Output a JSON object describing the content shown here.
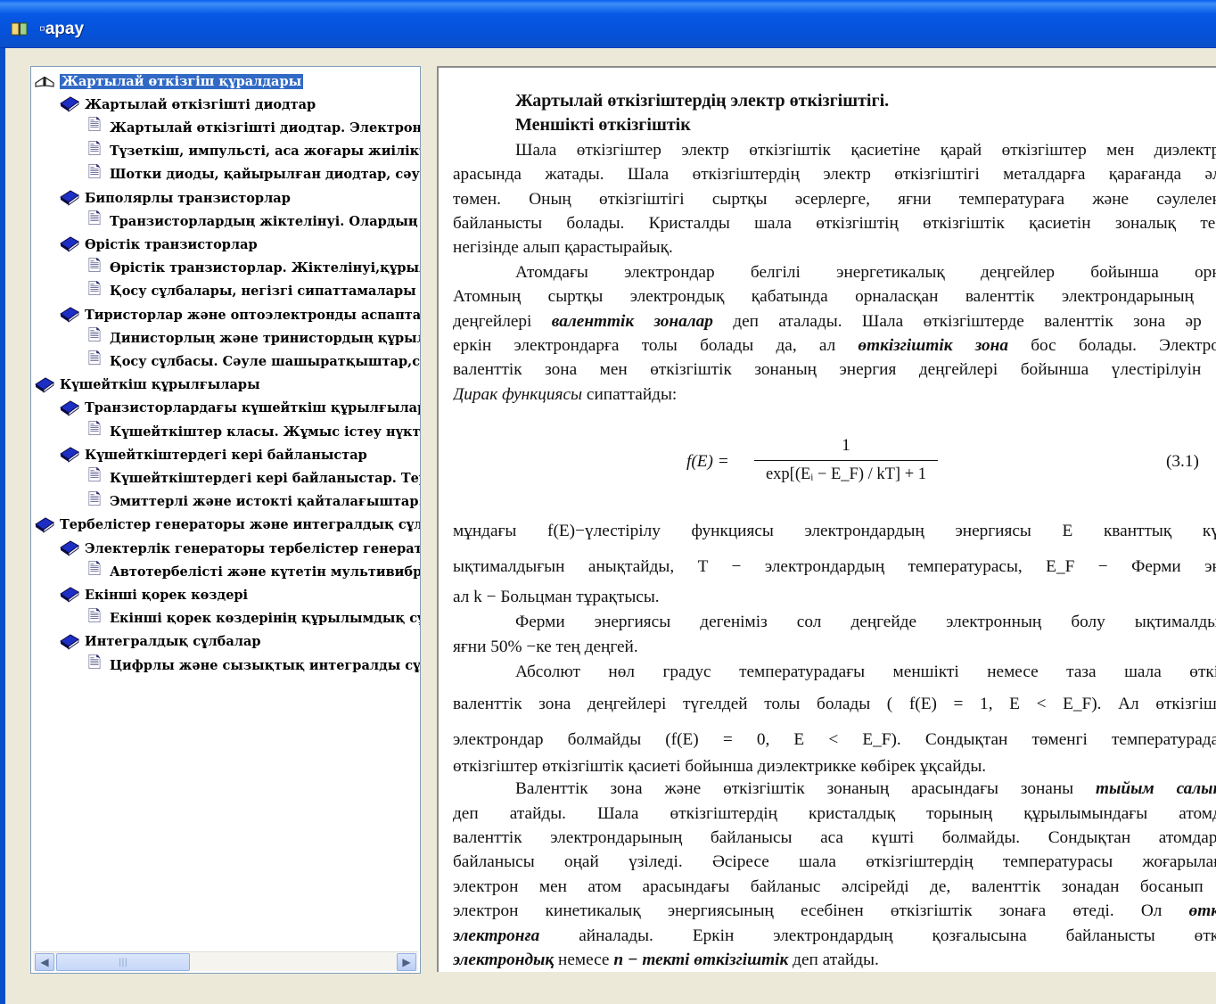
{
  "window": {
    "title": "Қарау",
    "title_display": "▫арау"
  },
  "tree": {
    "items": [
      {
        "label": "Жартылай өткізгіш құралдары",
        "icon": "open-book-icon",
        "level": 0
      },
      {
        "label": "Жартылай өткізгішті диодтар",
        "icon": "book-icon",
        "level": 1
      },
      {
        "label": "Жартылай өткізгішті диодтар. Электронд",
        "icon": "document-icon",
        "level": 2
      },
      {
        "label": "Түзеткіш, импульсті, аса жоғары жиіліктi",
        "icon": "document-icon",
        "level": 2
      },
      {
        "label": "Шотки диоды, қайырылған диодтар, сәул",
        "icon": "document-icon",
        "level": 2
      },
      {
        "label": "Биполярлы транзисторлар",
        "icon": "book-icon",
        "level": 1
      },
      {
        "label": "Транзисторлардың жіктелінуі. Олардың э",
        "icon": "document-icon",
        "level": 2
      },
      {
        "label": "Өрістік транзисторлар",
        "icon": "book-icon",
        "level": 1
      },
      {
        "label": "Өрістік транзисторлар. Жіктелінуі,құрылы",
        "icon": "document-icon",
        "level": 2
      },
      {
        "label": "Қосу сұлбалары, негізгі сипаттамалары ж",
        "icon": "document-icon",
        "level": 2
      },
      {
        "label": "Тиристорлар және оптоэлектронды аспаптар",
        "icon": "book-icon",
        "level": 1
      },
      {
        "label": "Динисторлың және тринистордың құрылы",
        "icon": "document-icon",
        "level": 2
      },
      {
        "label": "Қосу сұлбасы. Сәуле шашыратқыштар,сәу",
        "icon": "document-icon",
        "level": 2
      },
      {
        "label": "Күшейткіш құрылғылары",
        "icon": "book-icon",
        "level": 0
      },
      {
        "label": "Транзисторлардағы күшейткіш құрылғылар",
        "icon": "book-icon",
        "level": 1
      },
      {
        "label": "Күшейткіштер класы. Жұмыс істеу нүктес",
        "icon": "document-icon",
        "level": 2
      },
      {
        "label": "Күшейткіштердегі кері байланыстар",
        "icon": "book-icon",
        "level": 1
      },
      {
        "label": "Күшейткіштердегі кері байланыстар. Тері",
        "icon": "document-icon",
        "level": 2
      },
      {
        "label": "Эмиттерлі және истокті қайталағыштар.І",
        "icon": "document-icon",
        "level": 2
      },
      {
        "label": "Тербелістер генераторы және интегралдық сұлб",
        "icon": "book-icon",
        "level": 0
      },
      {
        "label": "Электерлік генераторы тербелістер генератор",
        "icon": "book-icon",
        "level": 1
      },
      {
        "label": "Автотербелісті және күтетін мультивибра",
        "icon": "document-icon",
        "level": 2
      },
      {
        "label": "Екінші қорек көздері",
        "icon": "book-icon",
        "level": 1
      },
      {
        "label": "Екінші қорек көздерінің құрылымдық сұл",
        "icon": "document-icon",
        "level": 2
      },
      {
        "label": "Интегралдық сұлбалар",
        "icon": "book-icon",
        "level": 1
      },
      {
        "label": "Цифрлы және сызықтық интегралды сұлб",
        "icon": "document-icon",
        "level": 2
      }
    ],
    "scroll_left_glyph": "◀",
    "scroll_right_glyph": "▶",
    "scroll_thumb_grip": "|||"
  },
  "content": {
    "heading1": "Жартылай  өткізгіштердің электр өткізгіштігі.",
    "heading2": "Меншікті өткізгіштік",
    "p1": [
      "Шала өткізгіштер электр өткізгіштік қасиетіне қарай өткізгіштер мен диэлектрик",
      "арасында жатады. Шала өткізгіштердің электр өткізгіштігі металдарға қарағанда әлде",
      "төмен. Оның өткізгіштігі сыртқы әсерлерге, яғни температураға және сәулеленут",
      "байланысты болады. Кристалды шала өткізгіштің өткізгіштік қасиетін зоналық теорі",
      "негізінде алып қарастырайық."
    ],
    "p2_l1": "Атомдағы электрондар белгілі энергетикалық деңгейлер бойынша орнал",
    "p2_l2": "Атомның сыртқы электрондық қабатында орналасқан валенттік электрондарының эн",
    "p2_l3a": "деңгейлері ",
    "p2_l3b": "валенттік зоналар",
    "p2_l3c": " деп аталады. Шала өткізгіштерде валенттік зона әр уа",
    "p2_l4a": "еркін электрондарға толы болады да, ал ",
    "p2_l4b": "өткізгіштік зона",
    "p2_l4c": " бос болады. Электронд",
    "p2_l5": "валенттік зона мен өткізгіштік зонаның энергия деңгейлері бойынша үлестірілуін Ф",
    "p2_l6a": "Дирак функциясы",
    "p2_l6b": " сипаттайды:",
    "formula": {
      "lhs": "f(E) =",
      "numerator": "1",
      "denominator": "exp[(Eᵢ − E_F) / kT] + 1",
      "trailing": ",",
      "number": "(3.1)"
    },
    "p3_l1": "мұндағы  f(E)−үлестірілу функциясы электрондардың энергиясы  E кванттық күйд",
    "p3_l2": "ықтималдығын анықтайды,  T − электрондардың температурасы,  E_F − Ферми энер",
    "p3_l3": "ал  k − Больцман тұрақтысы.",
    "p4_l1": "Ферми энергиясы дегеніміз сол деңгейде электронның болу ықтималдығы",
    "p4_l2": "яғни 50% −ке тең деңгей.",
    "p5_l1": "Абсолют нөл градус температурадағы меншікті немесе таза  шала өткізгі",
    "p5_l2": "валенттік зона деңгейлері түгелдей толы болады ( f(E) = 1, E < E_F). Ал өткізгіштік",
    "p5_l3": "электрондар болмайды (f(E) = 0, E < E_F). Сондықтан төменгі температурадағы",
    "p5_l4": "өткізгіштер өткізгіштік қасиеті бойынша диэлектрикке көбірек ұқсайды.",
    "p6_l1a": "Валенттік зона және өткізгіштік зонаның арасындағы зонаны ",
    "p6_l1b": "тыйым салынға",
    "p6_l2": "деп атайды. Шала өткізгіштердің кристалдық торының құрылымындағы атомдар",
    "p6_l3": "валенттік электрондарының байланысы аса күшті болмайды. Сондықтан атомдарды",
    "p6_l4": "байланысы оңай үзіледі. Әсіресе шала өткізгіштердің температурасы жоғарылаған",
    "p6_l5": "электрон мен атом арасындағы байланыс әлсірейді де, валенттік зонадан босанып ш",
    "p6_l6a": "электрон кинетикалық энергиясының есебінен өткізгіштік зонаға өтеді. Ол ",
    "p6_l6b": "өткізг",
    "p6_l7a": "электронға",
    "p6_l7b": " айналады. Еркін электрондардың қозғалысына байланысты өткізг",
    "p6_l8a": "электрондық",
    "p6_l8b": " немесе ",
    "p6_l8c": "n − текті өткізгіштік",
    "p6_l8d": " деп атайды."
  }
}
